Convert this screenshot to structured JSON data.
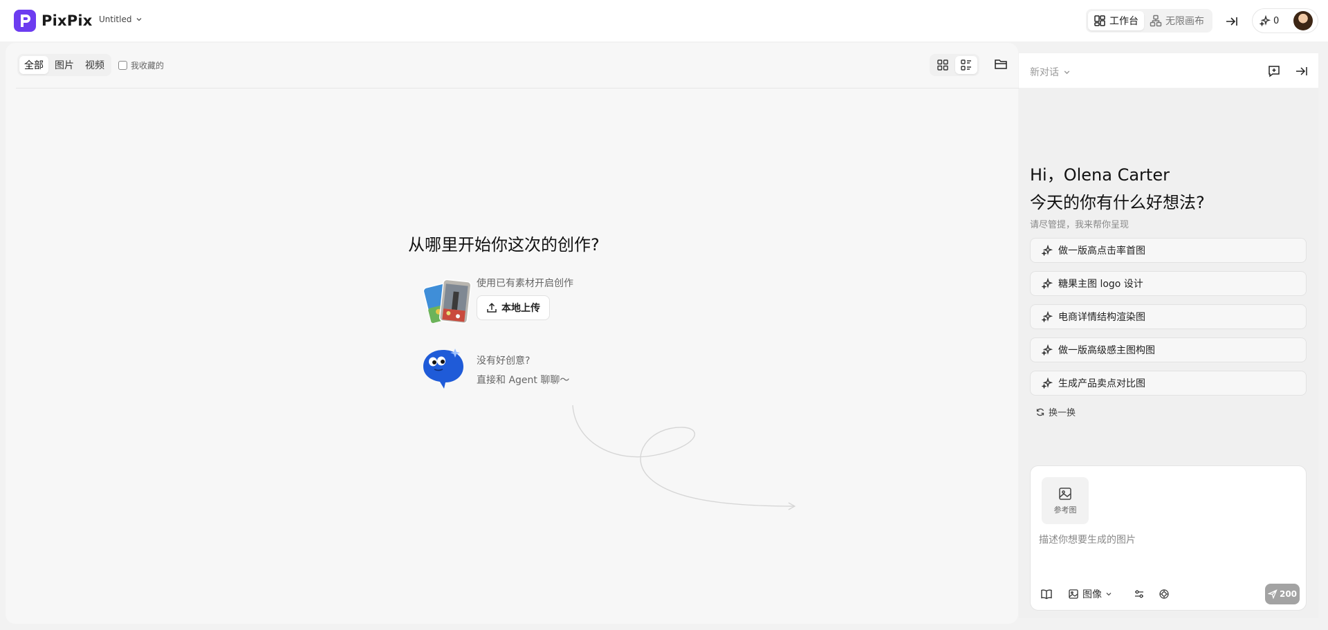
{
  "app": {
    "name": "PixPix",
    "file_title": "Untitled",
    "brand_color": "#6c3cf0",
    "icons": {
      "logo": "pixpix-logo-icon",
      "title_dropdown": "chevron-down-icon",
      "workspace": "grid-layout-icon",
      "canvas": "sitemap-icon",
      "collapse": "arrow-right-bar-icon",
      "credits": "sparkles-icon"
    }
  },
  "mode_switch": {
    "workspace_label": "工作台",
    "canvas_label": "无限画布",
    "active": "workspace"
  },
  "credits": {
    "count": "0"
  },
  "filters": {
    "tabs": [
      "全部",
      "图片",
      "视频"
    ],
    "active_tab": "全部",
    "favorites_label": "我收藏的",
    "favorites_checked": false,
    "view_modes": [
      "grid-view-icon",
      "list-view-icon"
    ],
    "active_view": "list-view-icon",
    "folder_icon": "folder-icon"
  },
  "main": {
    "title": "从哪里开始你这次的创作?",
    "upload_caption": "使用已有素材开启创作",
    "upload_button": "本地上传",
    "upload_icon": "upload-icon",
    "idea_question": "没有好创意?",
    "idea_hint": "直接和 Agent 聊聊～"
  },
  "chat": {
    "conversation_label": "新对话",
    "greeting_line1": "Hi，Olena Carter",
    "greeting_line2": "今天的你有什么好想法?",
    "greeting_sub": "请尽管提，我来帮你呈现",
    "suggestions": [
      "做一版高点击率首图",
      "糖果主图 logo 设计",
      "电商详情结构渲染图",
      "做一版高级感主图构图",
      "生成产品卖点对比图"
    ],
    "refresh_label": "换一换",
    "reference_label": "参考图",
    "input_placeholder": "描述你想要生成的图片",
    "model_label": "图像",
    "send_cost": "200",
    "icons": {
      "new_chat": "message-plus-icon",
      "collapse": "arrow-right-bar-icon",
      "suggestion": "sparkles-icon",
      "refresh": "refresh-icon",
      "reference": "image-icon",
      "book": "book-icon",
      "model": "image-icon",
      "settings": "sliders-icon",
      "style": "openai-icon",
      "send": "send-icon"
    }
  }
}
